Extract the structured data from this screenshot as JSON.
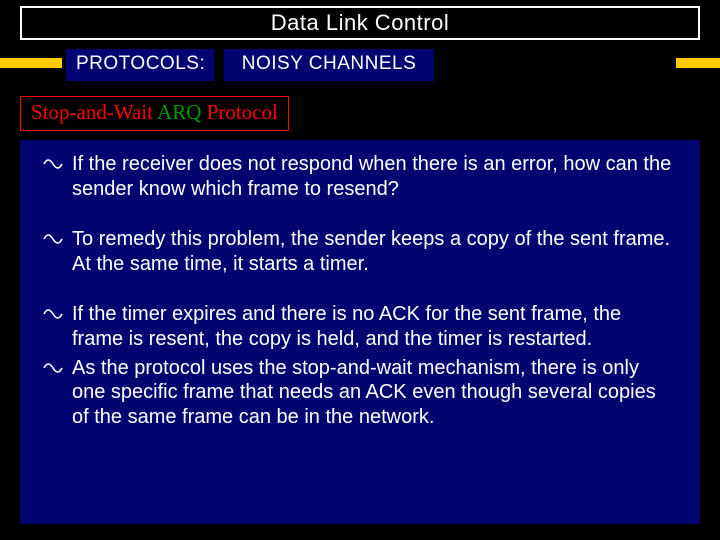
{
  "title": "Data Link Control",
  "chips": {
    "protocols": "PROTOCOLS:",
    "noisy": "NOISY CHANNELS"
  },
  "subtitle": {
    "part1": "Stop-and-Wait",
    "part2": " ARQ",
    "part3": " Protocol"
  },
  "bullets": [
    "If the receiver does not respond when there is an error, how can the sender know which frame to resend?",
    "To remedy this problem, the sender keeps a copy of the sent frame. At the same time, it starts a timer.",
    "If the timer expires and there is no ACK for the sent frame, the frame is resent, the copy is held, and the timer is restarted.",
    "As the protocol uses the stop-and-wait mechanism, there is only one specific frame that needs an ACK even though several copies of the same frame can be in the network."
  ]
}
